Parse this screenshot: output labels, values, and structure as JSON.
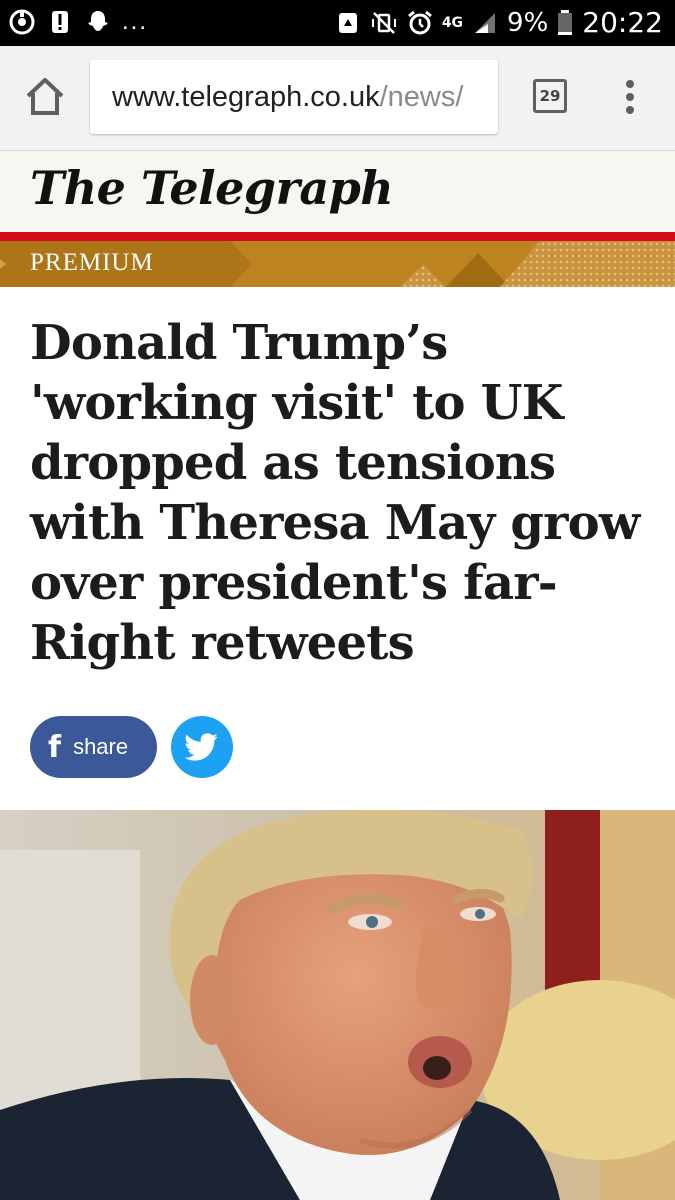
{
  "status_bar": {
    "more_indicator": "...",
    "network": "4G",
    "battery": "9%",
    "time": "20:22"
  },
  "browser": {
    "url_host": "www.telegraph.co.uk",
    "url_path": "/news/",
    "tab_count": "29"
  },
  "masthead": {
    "logo": "The Telegraph"
  },
  "article": {
    "label": "PREMIUM",
    "headline": "Donald Trump’s 'working visit' to UK dropped as tensions with Theresa May grow over president's far-Right retweets",
    "share_label": "share",
    "fb_glyph": "f"
  },
  "colors": {
    "premium_gold": "#bd8320",
    "telegraph_red": "#d20f16",
    "facebook_blue": "#3b5998",
    "twitter_blue": "#1da1f2"
  },
  "icons": {
    "home": "home-icon",
    "tabs": "tab-switcher-icon",
    "menu": "overflow-menu-icon",
    "facebook": "facebook-icon",
    "twitter": "twitter-bird-icon"
  }
}
